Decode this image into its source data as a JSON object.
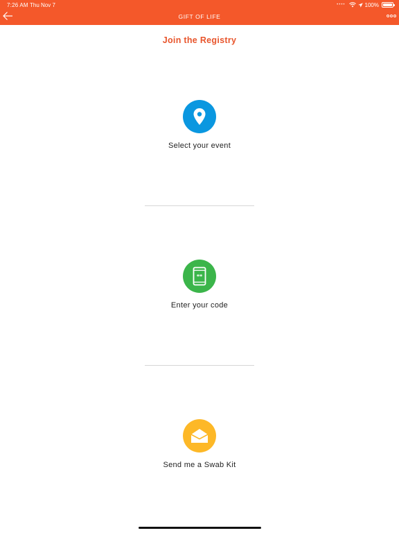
{
  "status_bar": {
    "time": "7:26 AM",
    "date": "Thu Nov 7",
    "battery": "100%",
    "battery_level": 1.0
  },
  "header": {
    "title": "GIFT OF LIFE",
    "back_icon": "back-arrow-icon",
    "more_icon": "more-options-icon"
  },
  "page": {
    "title": "Join the Registry"
  },
  "options": [
    {
      "label": "Select your event",
      "icon": "location-pin-icon",
      "color": "#0a97e0"
    },
    {
      "label": "Enter your code",
      "icon": "phone-code-icon",
      "color": "#3bb54a"
    },
    {
      "label": "Send me a Swab Kit",
      "icon": "envelope-icon",
      "color": "#fdb827"
    }
  ],
  "colors": {
    "brand": "#f4582a",
    "title_accent": "#e8552c"
  }
}
